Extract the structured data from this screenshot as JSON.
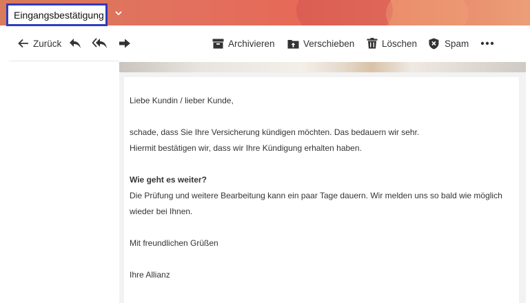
{
  "header": {
    "subject": "Eingangsbestätigung"
  },
  "toolbar": {
    "back_label": "Zurück",
    "archive_label": "Archivieren",
    "move_label": "Verschieben",
    "delete_label": "Löschen",
    "spam_label": "Spam"
  },
  "email": {
    "greeting": "Liebe Kundin / lieber Kunde,",
    "p1_line1": "schade, dass Sie Ihre Versicherung kündigen möchten. Das bedauern wir sehr.",
    "p1_line2": "Hiermit bestätigen wir, dass wir Ihre Kündigung erhalten haben.",
    "heading": "Wie geht es weiter?",
    "p2_line1": "Die Prüfung und weitere Bearbeitung kann ein paar Tage dauern. Wir melden uns so bald wie möglich",
    "p2_line2": "wieder bei Ihnen.",
    "closing": "Mit freundlichen Grüßen",
    "signature": "Ihre Allianz"
  },
  "icons": [
    "chevron-down-icon",
    "arrow-left-icon",
    "reply-icon",
    "reply-all-icon",
    "forward-icon",
    "archive-icon",
    "move-icon",
    "trash-icon",
    "shield-icon",
    "more-icon"
  ],
  "colors": {
    "subject_border": "#2d3bbf",
    "banner_start": "#d97a5a",
    "banner_end": "#eb9f78"
  }
}
